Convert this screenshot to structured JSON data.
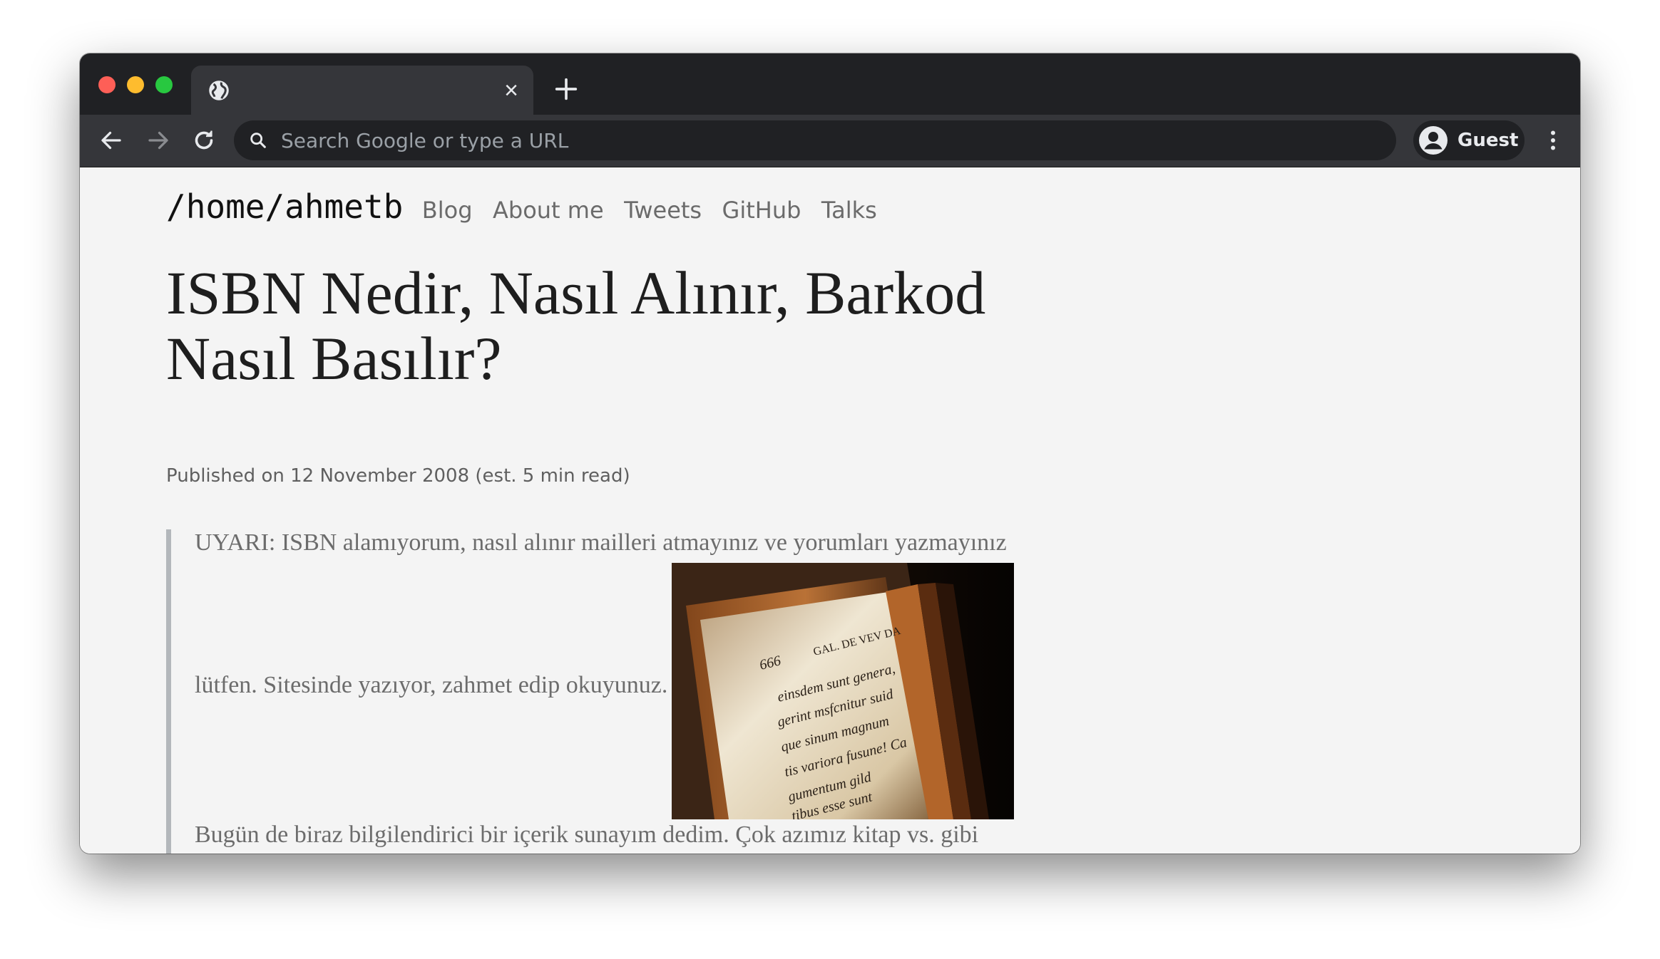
{
  "browser": {
    "tab": {
      "title": ""
    },
    "omnibox": {
      "placeholder": "Search Google or type a URL",
      "value": ""
    },
    "profile": {
      "label": "Guest"
    }
  },
  "site": {
    "brand": "/home/ahmetb",
    "nav": [
      "Blog",
      "About me",
      "Tweets",
      "GitHub",
      "Talks"
    ]
  },
  "post": {
    "title": "ISBN Nedir, Nasıl Alınır, Barkod Nasıl Basılır?",
    "meta": "Published on 12 November 2008 (est. 5 min read)",
    "quote_line1": "UYARI: ISBN alamıyorum, nasıl alınır mailleri atmayınız ve yorumları yazmayınız",
    "quote_line2": "lütfen. Sitesinde yazıyor, zahmet edip okuyunuz.",
    "paragraph": "Bugün de biraz bilgilendirici bir içerik sunayım dedim. Çok azımız kitap vs. gibi içerikler yazar ve yazdıklarını gizler. Kalan azınlığın çok azı da kitabını basmak ister fakat türlü engelden ötürü vazgeçer. Oradan da kalan azınlıktan da yine çok azı ise"
  },
  "book_image_text": [
    "666",
    "GAL. DE VEV DA",
    "einsdem sunt genera,",
    "gerint msfcnitur suid",
    "que sinum magnum",
    "tis variora fusune! Ca",
    "gumentum gild",
    "tibus esse sunt"
  ]
}
